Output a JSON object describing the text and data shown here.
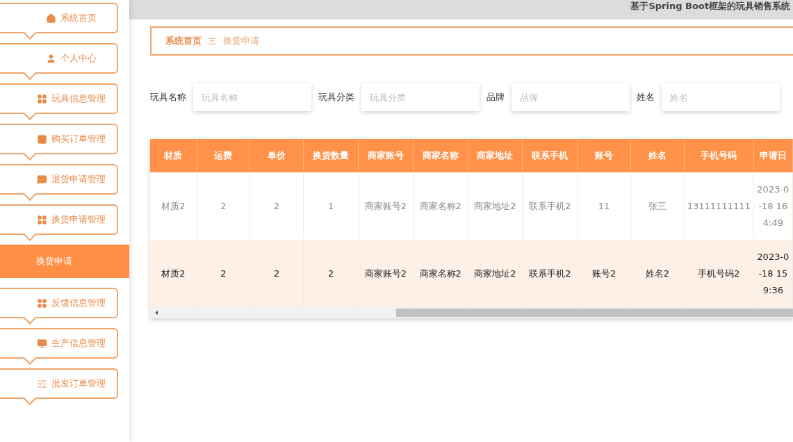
{
  "header": {
    "title": "基于Spring Boot框架的玩具销售系统"
  },
  "sidebar": {
    "items": [
      {
        "label": "系统首页"
      },
      {
        "label": "个人中心"
      },
      {
        "label": "玩具信息管理"
      },
      {
        "label": "购买订单管理"
      },
      {
        "label": "退货申请管理"
      },
      {
        "label": "换货申请管理",
        "children": [
          {
            "label": "换货申请",
            "selected": true
          }
        ]
      },
      {
        "label": "反馈信息管理"
      },
      {
        "label": "生产信息管理"
      },
      {
        "label": "批发订单管理"
      }
    ]
  },
  "breadcrumb": {
    "home": "系统首页",
    "separator": "三",
    "current": "换货申请"
  },
  "filters": [
    {
      "label": "玩具名称",
      "placeholder": "玩具名称"
    },
    {
      "label": "玩具分类",
      "placeholder": "玩具分类"
    },
    {
      "label": "品牌",
      "placeholder": "品牌"
    },
    {
      "label": "姓名",
      "placeholder": "姓名"
    }
  ],
  "table": {
    "columns": [
      "材质",
      "运费",
      "单价",
      "换货数量",
      "商家账号",
      "商家名称",
      "商家地址",
      "联系手机",
      "账号",
      "姓名",
      "手机号码",
      "申请日"
    ],
    "rows": [
      {
        "selected": false,
        "cells": [
          "材质2",
          "2",
          "2",
          "1",
          "商家账号2",
          "商家名称2",
          "商家地址2",
          "联系手机2",
          "11",
          "张三",
          "13111111111",
          "2023-0\n-18 16\n4:49"
        ]
      },
      {
        "selected": true,
        "cells": [
          "材质2",
          "2",
          "2",
          "2",
          "商家账号2",
          "商家名称2",
          "商家地址2",
          "联系手机2",
          "账号2",
          "姓名2",
          "手机号码2",
          "2023-0\n-18 15\n9:36"
        ]
      }
    ]
  }
}
